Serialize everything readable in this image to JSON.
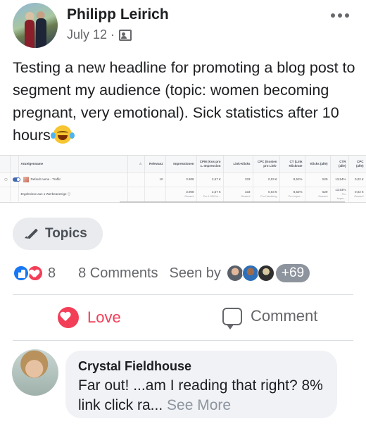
{
  "post": {
    "author": "Philipp Leirich",
    "date": "July 12 ·",
    "privacy_icon": "group-icon",
    "text": "Testing a new headline for promoting a blog post to segment my audience (topic: women becoming pregnant, very emotional). Sick statistics after 10 hours",
    "emoji": "tears-of-joy-emoji"
  },
  "ads_table": {
    "headers": [
      "Anzeigenname",
      "Relevanz",
      "Impressionen",
      "CPM (Kos pro 1. Impression",
      "Link-Klicks",
      "CPC (Kosten pro Link-",
      "CT (Link Klickrate",
      "Klicks (alle)",
      "CTR (alle)",
      "CPC (alle)"
    ],
    "rows": [
      {
        "name": "Default name - Traffic",
        "relevanz": "10",
        "impressionen": "3.908",
        "cpm": "2,57 €",
        "link_klicks": "333",
        "cpc": "0,03 €",
        "ct": "8,52%",
        "klicks_alle": "529",
        "ctr_alle": "13,54%",
        "cpc_alle": "0,02 €"
      },
      {
        "name": "Ergebnisse aus 1 Werbeanzeige",
        "relevanz": "",
        "impressionen": "3.908",
        "cpm": "2,57 €",
        "link_klicks": "333",
        "cpc": "0,03 €",
        "ct": "8,52%",
        "klicks_alle": "529",
        "ctr_alle": "13,54%",
        "cpc_alle": "0,02 €"
      }
    ],
    "summary_subs": [
      "Gesamt",
      "Pro 1.000 Im...",
      "Gesamt",
      "Pro Handlung",
      "Pro Impre...",
      "Gesamt",
      "Pro Impre...",
      "Gesamt"
    ]
  },
  "topics": {
    "label": "Topics",
    "icon": "pencil-icon"
  },
  "reactions": {
    "count": "8",
    "comments": "8 Comments",
    "seen_by": "Seen by",
    "seen_more": "+69"
  },
  "actions": {
    "love": "Love",
    "comment": "Comment"
  },
  "comment": {
    "author": "Crystal Fieldhouse",
    "text": "Far out! ...am I reading that right? 8% link click ra...",
    "see_more": "See More"
  },
  "colors": {
    "facebook_blue": "#1877f2",
    "love_red": "#f33e58",
    "meta_gray": "#65676b"
  }
}
